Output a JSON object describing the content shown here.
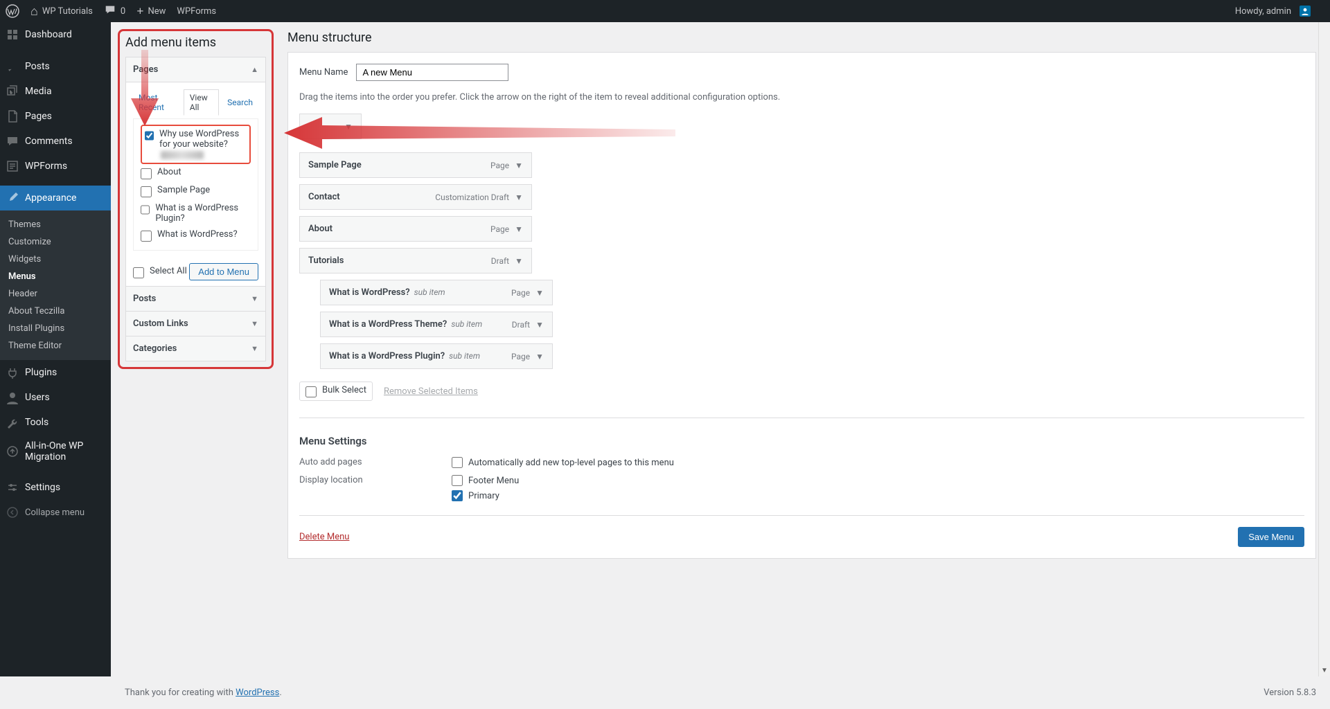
{
  "adminbar": {
    "site_title": "WP Tutorials",
    "comments_count": "0",
    "new_label": "New",
    "wpforms_label": "WPForms",
    "howdy": "Howdy, admin"
  },
  "sidebar": {
    "items": [
      {
        "label": "Dashboard",
        "icon": "dashboard"
      },
      {
        "label": "Posts",
        "icon": "pin"
      },
      {
        "label": "Media",
        "icon": "media"
      },
      {
        "label": "Pages",
        "icon": "pages"
      },
      {
        "label": "Comments",
        "icon": "comments"
      },
      {
        "label": "WPForms",
        "icon": "wpforms"
      },
      {
        "label": "Appearance",
        "icon": "brush",
        "active": true
      },
      {
        "label": "Plugins",
        "icon": "plug"
      },
      {
        "label": "Users",
        "icon": "user"
      },
      {
        "label": "Tools",
        "icon": "wrench"
      },
      {
        "label": "All-in-One WP Migration",
        "icon": "migration"
      },
      {
        "label": "Settings",
        "icon": "settings"
      },
      {
        "label": "Collapse menu",
        "icon": "collapse"
      }
    ],
    "appearance_submenu": [
      "Themes",
      "Customize",
      "Widgets",
      "Menus",
      "Header",
      "About Teczilla",
      "Install Plugins",
      "Theme Editor"
    ],
    "appearance_submenu_active": "Menus"
  },
  "addmenu": {
    "heading": "Add menu items",
    "sections": {
      "pages": {
        "label": "Pages",
        "expanded": true
      },
      "posts": {
        "label": "Posts"
      },
      "custom_links": {
        "label": "Custom Links"
      },
      "categories": {
        "label": "Categories"
      }
    },
    "tabs": {
      "most_recent": "Most Recent",
      "view_all": "View All",
      "search": "Search",
      "active": "View All"
    },
    "page_list": [
      {
        "label": "Why use WordPress for your website?",
        "checked": true
      },
      {
        "label": "About",
        "checked": false
      },
      {
        "label": "Sample Page",
        "checked": false
      },
      {
        "label": "What is a WordPress Plugin?",
        "checked": false
      },
      {
        "label": "What is WordPress?",
        "checked": false
      }
    ],
    "select_all": "Select All",
    "add_to_menu": "Add to Menu"
  },
  "structure": {
    "heading": "Menu structure",
    "menu_name_label": "Menu Name",
    "menu_name_value": "A new Menu",
    "instructions": "Drag the items into the order you prefer. Click the arrow on the right of the item to reveal additional configuration options.",
    "items": [
      {
        "title": "",
        "type": "",
        "obscured": true
      },
      {
        "title": "Sample Page",
        "type": "Page"
      },
      {
        "title": "Contact",
        "type": "Customization Draft"
      },
      {
        "title": "About",
        "type": "Page"
      },
      {
        "title": "Tutorials",
        "type": "Draft"
      },
      {
        "title": "What is WordPress?",
        "type": "Page",
        "sub": true,
        "subitem_label": "sub item"
      },
      {
        "title": "What is a WordPress Theme?",
        "type": "Draft",
        "sub": true,
        "subitem_label": "sub item"
      },
      {
        "title": "What is a WordPress Plugin?",
        "type": "Page",
        "sub": true,
        "subitem_label": "sub item"
      }
    ],
    "bulk_select": "Bulk Select",
    "remove_selected": "Remove Selected Items"
  },
  "settings": {
    "heading": "Menu Settings",
    "auto_add_label": "Auto add pages",
    "auto_add_checkbox": "Automatically add new top-level pages to this menu",
    "display_location_label": "Display location",
    "locations": [
      {
        "label": "Footer Menu",
        "checked": false
      },
      {
        "label": "Primary",
        "checked": true
      }
    ],
    "delete_menu": "Delete Menu",
    "save_menu": "Save Menu"
  },
  "footer": {
    "thank_you_prefix": "Thank you for creating with ",
    "thank_you_link": "WordPress",
    "thank_you_suffix": ".",
    "version": "Version 5.8.3"
  }
}
